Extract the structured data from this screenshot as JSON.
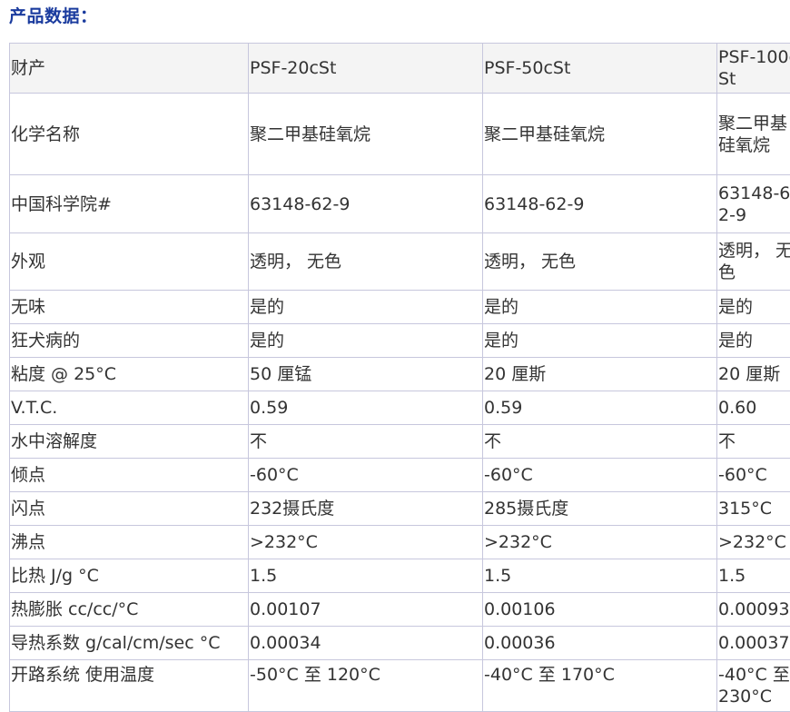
{
  "section_title": "产品数据：",
  "table": {
    "columns": [
      "财产",
      "PSF-20cSt",
      "PSF-50cSt",
      "PSF-100cSt"
    ],
    "rows": [
      [
        "化学名称",
        "聚二甲基硅氧烷",
        "聚二甲基硅氧烷",
        "聚二甲基硅氧烷"
      ],
      [
        "中国科学院#",
        "63148-62-9",
        "63148-62-9",
        "63148-62-9"
      ],
      [
        "外观",
        "透明， 无色",
        "透明， 无色",
        "透明， 无色"
      ],
      [
        "无味",
        "是的",
        "是的",
        "是的"
      ],
      [
        "狂犬病的",
        "是的",
        "是的",
        "是的"
      ],
      [
        "粘度 @ 25°C",
        "50 厘锰",
        "20 厘斯",
        "20 厘斯"
      ],
      [
        "V.T.C.",
        "0.59",
        "0.59",
        "0.60"
      ],
      [
        "水中溶解度",
        "不",
        "不",
        "不"
      ],
      [
        "倾点",
        "-60°C",
        "-60°C",
        "-60°C"
      ],
      [
        "闪点",
        "232摄氏度",
        "285摄氏度",
        "315°C"
      ],
      [
        "沸点",
        ">232°C",
        ">232°C",
        ">232°C"
      ],
      [
        "比热 J/g °C",
        "1.5",
        "1.5",
        "1.5"
      ],
      [
        "热膨胀 cc/cc/°C",
        "0.00107",
        "0.00106",
        "0.00093"
      ],
      [
        "导热系数 g/cal/cm/sec °C",
        "0.00034",
        "0.00036",
        "0.00037"
      ],
      [
        "开路系统 使用温度",
        "-50°C 至 120°C",
        "-40°C 至 170°C",
        "-40°C 至 230°C"
      ]
    ]
  },
  "colors": {
    "heading": "#1a3b9e",
    "grid": "#c7c7dd",
    "header_bg": "#f4f4f4",
    "text": "#333333"
  }
}
